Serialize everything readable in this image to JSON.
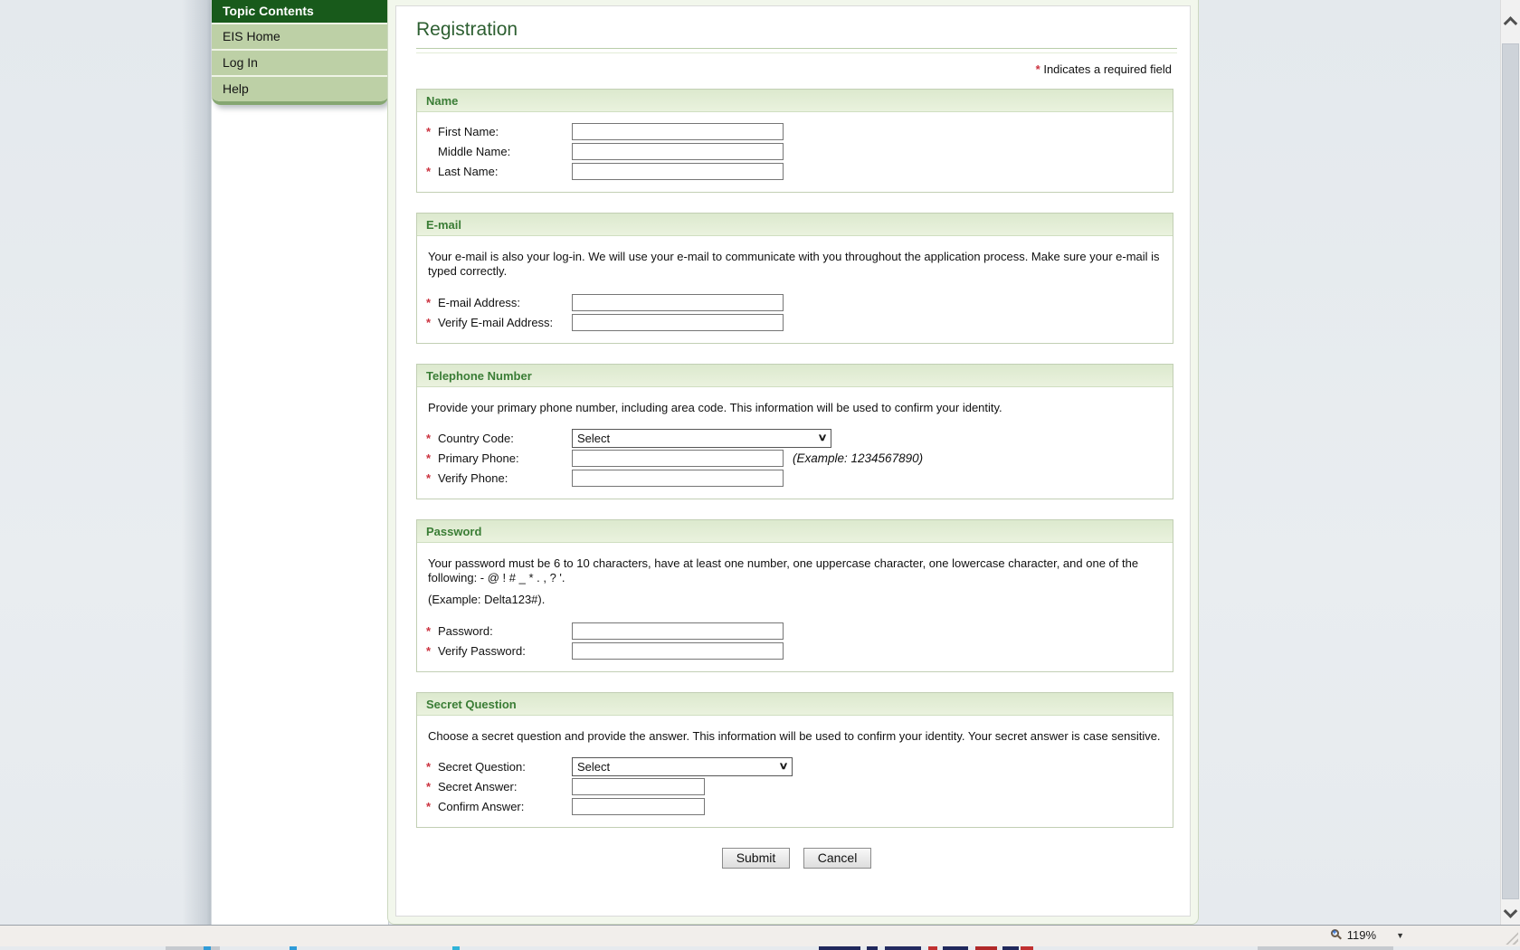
{
  "sidebar": {
    "header": "Topic Contents",
    "items": [
      {
        "label": "EIS Home"
      },
      {
        "label": "Log In"
      },
      {
        "label": "Help"
      }
    ]
  },
  "main": {
    "title": "Registration",
    "required_marker": "*",
    "required_note": "Indicates a required field",
    "sections": [
      {
        "id": "name",
        "title": "Name",
        "description": [],
        "fields": [
          {
            "label": "First Name:",
            "required": true,
            "control": "input",
            "value": ""
          },
          {
            "label": "Middle Name:",
            "required": false,
            "control": "input",
            "value": ""
          },
          {
            "label": "Last Name:",
            "required": true,
            "control": "input",
            "value": ""
          }
        ]
      },
      {
        "id": "email",
        "title": "E-mail",
        "description": [
          "Your e-mail is also your log-in. We will use your e-mail to communicate with you throughout the application process. Make sure your e-mail is typed correctly."
        ],
        "fields": [
          {
            "label": "E-mail Address:",
            "required": true,
            "control": "input",
            "value": ""
          },
          {
            "label": "Verify E-mail Address:",
            "required": true,
            "control": "input",
            "value": ""
          }
        ]
      },
      {
        "id": "telephone",
        "title": "Telephone Number",
        "description": [
          "Provide your primary phone number, including area code. This information will be used to confirm your identity."
        ],
        "fields": [
          {
            "label": "Country Code:",
            "required": true,
            "control": "select",
            "value": "Select"
          },
          {
            "label": "Primary Phone:",
            "required": true,
            "control": "input",
            "value": "",
            "hint": "(Example: 1234567890)"
          },
          {
            "label": "Verify Phone:",
            "required": true,
            "control": "input",
            "value": ""
          }
        ]
      },
      {
        "id": "password",
        "title": "Password",
        "description": [
          "Your password must be 6 to 10 characters, have at least one number, one uppercase character, one lowercase character, and one of the following: - @ ! # _ * . , ? '.",
          "(Example: Delta123#)."
        ],
        "fields": [
          {
            "label": "Password:",
            "required": true,
            "control": "input",
            "value": ""
          },
          {
            "label": "Verify Password:",
            "required": true,
            "control": "input",
            "value": ""
          }
        ]
      },
      {
        "id": "secret-question",
        "title": "Secret Question",
        "description": [
          "Choose a secret question and provide the answer.  This information will be used to confirm your identity. Your secret answer is case sensitive."
        ],
        "fields": [
          {
            "label": "Secret Question:",
            "required": true,
            "control": "select",
            "value": "Select"
          },
          {
            "label": "Secret Answer:",
            "required": true,
            "control": "input",
            "value": ""
          },
          {
            "label": "Confirm Answer:",
            "required": true,
            "control": "input",
            "value": ""
          }
        ]
      }
    ],
    "buttons": {
      "submit": "Submit",
      "cancel": "Cancel"
    }
  },
  "status_bar": {
    "zoom_level": "119%",
    "zoom_icon": "magnifier-plus-icon",
    "dropdown_icon": "caret-down-icon"
  },
  "scrollbar": {
    "up_icon": "chevron-up-icon",
    "down_icon": "chevron-down-icon"
  },
  "colors": {
    "sidebar_header_green": "#185a1b",
    "sidebar_item_green": "#bdd0a6",
    "section_header_text_green": "#3a7d35",
    "section_bar_green": "#dce9ce",
    "required_red": "#cc3340",
    "title_green": "#2d5f31"
  }
}
